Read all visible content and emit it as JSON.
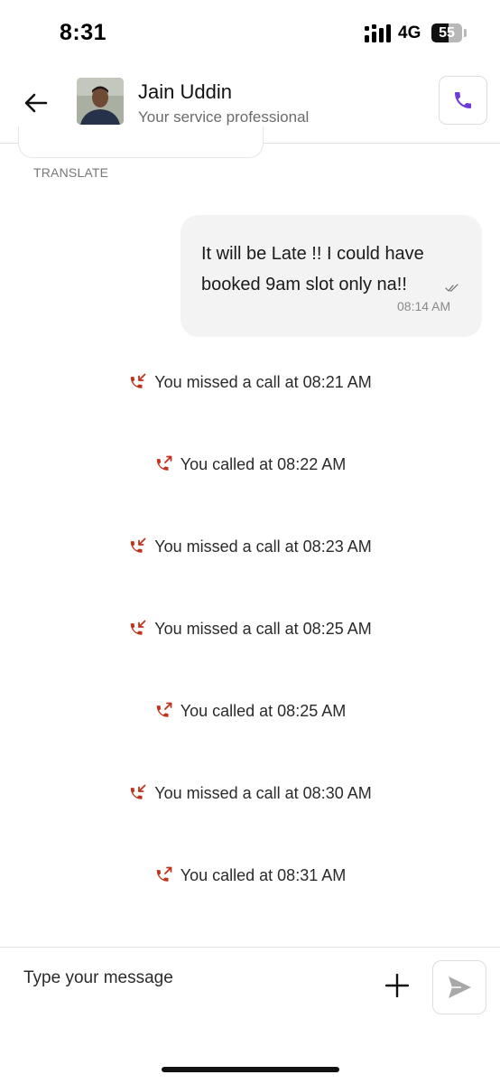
{
  "status_bar": {
    "time": "8:31",
    "network": "4G",
    "battery_level": "55",
    "battery_fraction": 0.55
  },
  "header": {
    "contact_name": "Jain Uddin",
    "contact_subtitle": "Your service professional",
    "back_icon": "arrow-left-icon",
    "call_icon": "phone-icon",
    "call_icon_color": "#6f3bd8"
  },
  "chat": {
    "translate_label": "TRANSLATE",
    "outgoing_message": {
      "text": "It will be Late !! I could have booked 9am slot only na!!",
      "time": "08:14 AM",
      "status_icon": "double-check-icon"
    },
    "call_logs": [
      {
        "type": "missed",
        "icon": "missed-call-icon",
        "text": "You missed a call at 08:21 AM"
      },
      {
        "type": "outgoing",
        "icon": "outgoing-call-icon",
        "text": "You called at 08:22 AM"
      },
      {
        "type": "missed",
        "icon": "missed-call-icon",
        "text": "You missed a call at 08:23 AM"
      },
      {
        "type": "missed",
        "icon": "missed-call-icon",
        "text": "You missed a call at 08:25 AM"
      },
      {
        "type": "outgoing",
        "icon": "outgoing-call-icon",
        "text": "You called at 08:25 AM"
      },
      {
        "type": "missed",
        "icon": "missed-call-icon",
        "text": "You missed a call at 08:30 AM"
      },
      {
        "type": "outgoing",
        "icon": "outgoing-call-icon",
        "text": "You called at 08:31 AM"
      }
    ],
    "call_icon_color": "#c0321c"
  },
  "composer": {
    "placeholder": "Type your message",
    "value": "",
    "add_icon": "plus-icon",
    "send_icon": "send-icon"
  }
}
